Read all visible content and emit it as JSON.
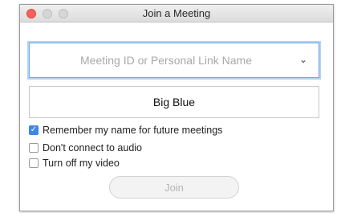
{
  "window": {
    "title": "Join a Meeting"
  },
  "meeting_field": {
    "placeholder": "Meeting ID or Personal Link Name",
    "value": ""
  },
  "name_field": {
    "value": "Big Blue"
  },
  "options": [
    {
      "label": "Remember my name for future meetings",
      "checked": true
    },
    {
      "label": "Don't connect to audio",
      "checked": false
    },
    {
      "label": "Turn off my video",
      "checked": false
    }
  ],
  "join_button": {
    "label": "Join",
    "enabled": false
  },
  "icons": {
    "close": "close-icon",
    "minimize": "minimize-icon",
    "zoom": "zoom-icon",
    "dropdown": "chevron-down-icon",
    "check": "checkmark-icon"
  },
  "colors": {
    "accent": "#3d87e8",
    "focus_ring": "#74a7e6",
    "close_light": "#fc605b"
  }
}
